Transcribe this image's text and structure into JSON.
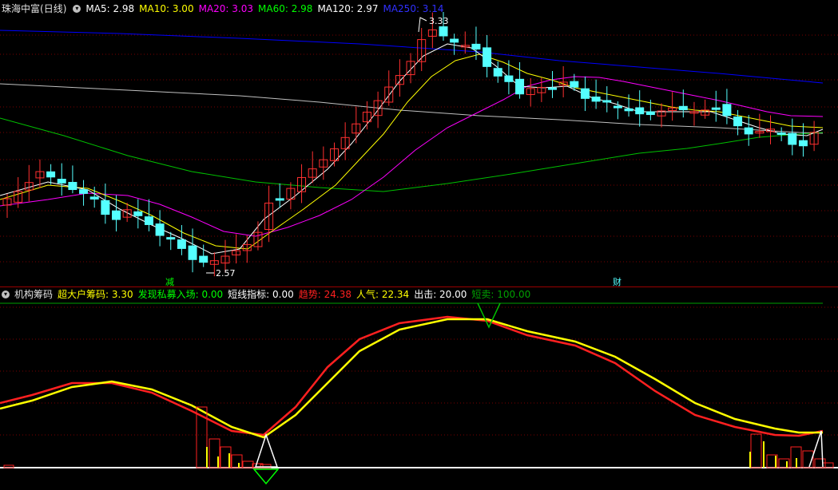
{
  "main_header": {
    "title": "珠海中富",
    "period": "(日线)",
    "indicators": [
      {
        "label": "MA5: 2.98",
        "color": "#ffffff"
      },
      {
        "label": "MA10: 3.00",
        "color": "#ffff00"
      },
      {
        "label": "MA20: 3.03",
        "color": "#ff00ff"
      },
      {
        "label": "MA60: 2.98",
        "color": "#00ff00"
      },
      {
        "label": "MA120: 2.97",
        "color": "#ffffff"
      },
      {
        "label": "MA250: 3.14",
        "color": "#0000ff"
      }
    ]
  },
  "sub_header": {
    "title": "机构筹码",
    "indicators": [
      {
        "label": "超大户筹码: 3.30",
        "color": "#ffff00"
      },
      {
        "label": "发现私募入场: 0.00",
        "color": "#00ff00"
      },
      {
        "label": "短线指标: 0.00",
        "color": "#ffffff"
      },
      {
        "label": "趋势: 24.38",
        "color": "#ff2020"
      },
      {
        "label": "人气: 22.34",
        "color": "#ffff00"
      },
      {
        "label": "出击: 20.00",
        "color": "#ffffff"
      },
      {
        "label": "短卖: 100.00",
        "color": "#00a000"
      }
    ]
  },
  "annotations": {
    "high": "3.33",
    "low": "2.57",
    "marker_left": "减",
    "marker_right": "财"
  },
  "colors": {
    "up": "#ff3030",
    "down": "#54ffff",
    "grid": "#7a0000",
    "ma5": "#ffffff",
    "ma10": "#ffff00",
    "ma20": "#ff00ff",
    "ma60": "#00c000",
    "ma120": "#c0c0c0",
    "ma250": "#0000ff"
  },
  "chart_data": [
    {
      "type": "candlestick",
      "high": 3.33,
      "low": 2.57,
      "series": [
        {
          "name": "MA5",
          "current": 2.98
        },
        {
          "name": "MA10",
          "current": 3.0
        },
        {
          "name": "MA20",
          "current": 3.03
        },
        {
          "name": "MA60",
          "current": 2.98
        },
        {
          "name": "MA120",
          "current": 2.97
        },
        {
          "name": "MA250",
          "current": 3.14
        }
      ]
    },
    {
      "type": "line",
      "series": [
        {
          "name": "超大户筹码",
          "current": 3.3
        },
        {
          "name": "发现私募入场",
          "current": 0.0
        },
        {
          "name": "短线指标",
          "current": 0.0
        },
        {
          "name": "趋势",
          "current": 24.38
        },
        {
          "name": "人气",
          "current": 22.34
        },
        {
          "name": "出击",
          "current": 20.0
        },
        {
          "name": "短卖",
          "current": 100.0
        }
      ]
    }
  ]
}
